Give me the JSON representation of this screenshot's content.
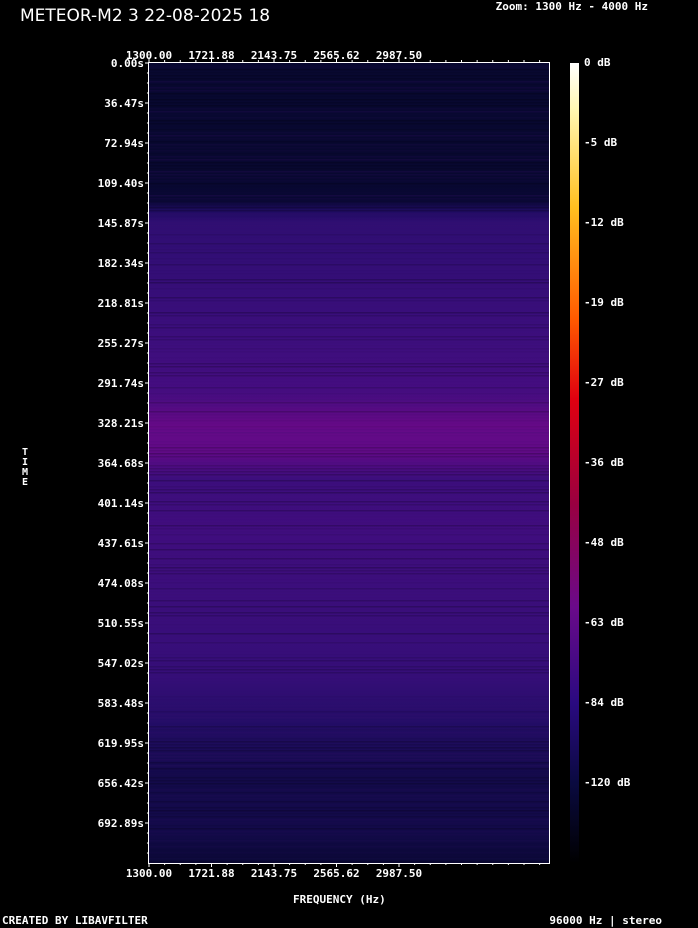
{
  "header": {
    "title": "METEOR-M2 3 22-08-2025 18",
    "zoom": "Zoom: 1300 Hz - 4000 Hz"
  },
  "footer": {
    "left": "CREATED BY LIBAVFILTER",
    "right": "96000 Hz | stereo"
  },
  "chart_data": {
    "type": "heatmap",
    "title": "METEOR-M2 3 22-08-2025 18",
    "xlabel": "FREQUENCY (Hz)",
    "ylabel": "TIME",
    "x_ticks": [
      "1300.00",
      "1721.88",
      "2143.75",
      "2565.62",
      "2987.50"
    ],
    "x_tick_values": [
      1300.0,
      1721.88,
      2143.75,
      2565.62,
      2987.5
    ],
    "xlim": [
      1300,
      4000
    ],
    "y_ticks": [
      "0.00s",
      "36.47s",
      "72.94s",
      "109.40s",
      "145.87s",
      "182.34s",
      "218.81s",
      "255.27s",
      "291.74s",
      "328.21s",
      "364.68s",
      "401.14s",
      "437.61s",
      "474.08s",
      "510.55s",
      "547.02s",
      "583.48s",
      "619.95s",
      "656.42s",
      "692.89s"
    ],
    "y_tick_values": [
      0.0,
      36.47,
      72.94,
      109.4,
      145.87,
      182.34,
      218.81,
      255.27,
      291.74,
      328.21,
      364.68,
      401.14,
      437.61,
      474.08,
      510.55,
      547.02,
      583.48,
      619.95,
      656.42,
      692.89
    ],
    "ylim": [
      0,
      729.36
    ],
    "colorbar_labels": [
      "0 dB",
      "-5 dB",
      "-12 dB",
      "-19 dB",
      "-27 dB",
      "-36 dB",
      "-48 dB",
      "-63 dB",
      "-84 dB",
      "-120 dB"
    ],
    "colorbar_values": [
      0,
      -5,
      -12,
      -19,
      -27,
      -36,
      -48,
      -63,
      -84,
      -120
    ],
    "colorbar_range": [
      -160,
      0
    ],
    "intensity_profile": {
      "time_s": [
        0,
        100,
        125,
        135,
        145,
        200,
        250,
        300,
        330,
        355,
        380,
        420,
        500,
        560,
        600,
        650,
        700,
        729.36
      ],
      "level_db": [
        -128,
        -128,
        -127,
        -108,
        -96,
        -90,
        -84,
        -80,
        -66,
        -68,
        -84,
        -82,
        -86,
        -90,
        -104,
        -118,
        -118,
        -126
      ]
    },
    "colors": {
      "background": "#000000",
      "frame": "#ffffff",
      "colormap_low": "#000000",
      "colormap_mid": "#6a0a8a",
      "colormap_high": "#ff3000",
      "colormap_top": "#ffffff"
    },
    "grid": false
  }
}
